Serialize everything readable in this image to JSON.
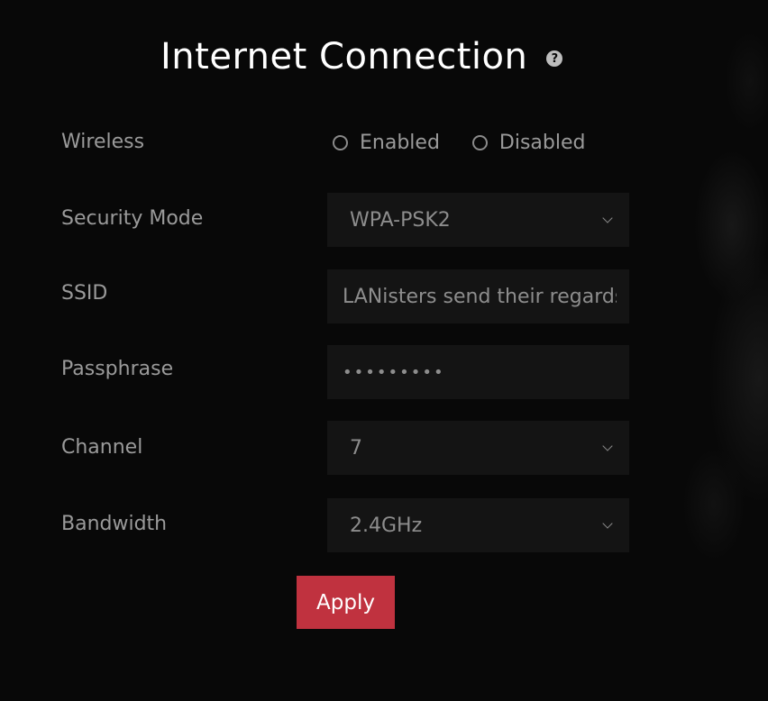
{
  "header": {
    "title": "Internet Connection",
    "help_icon": "?"
  },
  "wireless": {
    "label": "Wireless",
    "options": [
      "Enabled",
      "Disabled"
    ],
    "selected": null
  },
  "security_mode": {
    "label": "Security Mode",
    "value": "WPA-PSK2"
  },
  "ssid": {
    "label": "SSID",
    "value": "LANisters send their regards"
  },
  "passphrase": {
    "label": "Passphrase",
    "masked_value": "•••••••••"
  },
  "channel": {
    "label": "Channel",
    "value": "7"
  },
  "bandwidth": {
    "label": "Bandwidth",
    "value": "2.4GHz"
  },
  "actions": {
    "apply_label": "Apply"
  },
  "colors": {
    "background": "#080808",
    "field_background": "#141414",
    "accent": "#c0323f",
    "text": "#9a9a9a",
    "title": "#ffffff"
  },
  "icons": {
    "help": "help-icon",
    "dropdown": "chevron-down-icon",
    "radio": "radio-unchecked-icon"
  }
}
